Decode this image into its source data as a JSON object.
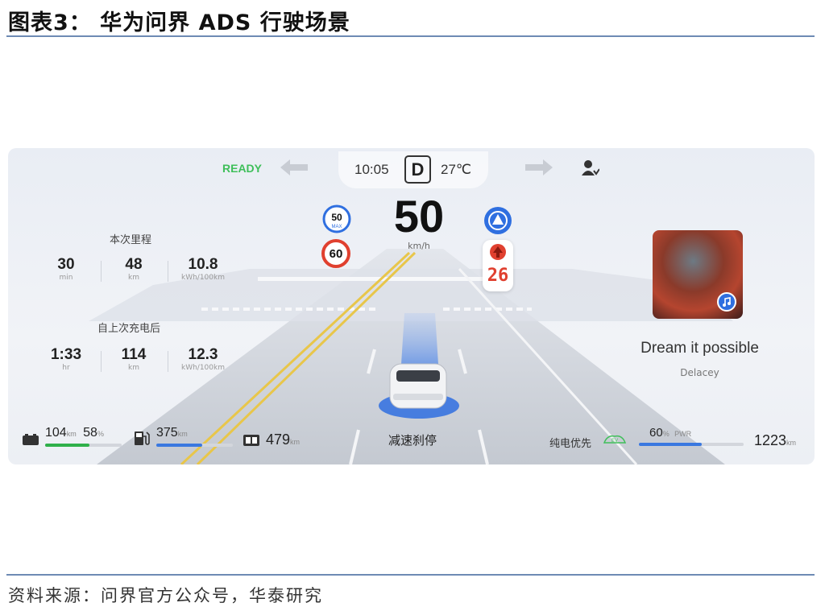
{
  "figure": {
    "title": "图表3： 华为问界 ADS 行驶场景",
    "source": "资料来源：问界官方公众号，华泰研究"
  },
  "dashboard": {
    "status": "READY",
    "time": "10:05",
    "gear": "D",
    "temperature": "27℃",
    "speed": "50",
    "speed_unit": "km/h",
    "max_speed": "50",
    "max_label": "MAX",
    "speed_limit": "60",
    "traffic_light_countdown": "26",
    "trip": {
      "title": "本次里程",
      "stats": [
        {
          "value": "30",
          "unit": "min"
        },
        {
          "value": "48",
          "unit": "km"
        },
        {
          "value": "10.8",
          "unit": "kWh/100km"
        }
      ]
    },
    "since_charge": {
      "title": "自上次充电后",
      "stats": [
        {
          "value": "1:33",
          "unit": "hr"
        },
        {
          "value": "114",
          "unit": "km"
        },
        {
          "value": "12.3",
          "unit": "kWh/100km"
        }
      ]
    },
    "battery": {
      "range": "104",
      "range_unit": "km",
      "percent": "58",
      "percent_unit": "%",
      "fill": 0.58
    },
    "fuel": {
      "range": "375",
      "range_unit": "km",
      "fill": 0.6
    },
    "total_range": {
      "value": "479",
      "unit": "km"
    },
    "brake_status": "减速刹停",
    "drive_mode": "纯电优先",
    "ev_label": "EV",
    "power": {
      "value": "60",
      "unit": "%",
      "label": "PWR",
      "fill": 0.6
    },
    "odometer": {
      "value": "1223",
      "unit": "km"
    },
    "media": {
      "song": "Dream it possible",
      "artist": "Delacey"
    }
  },
  "colors": {
    "ready": "#3fbf5a",
    "battery_bar": "#2fb04a",
    "fuel_bar": "#3a78e0",
    "accent_blue": "#2f6fe0",
    "road": "#cdd1d8",
    "lane_yellow": "#e8c64a",
    "countdown_red": "#e0402f",
    "rule_blue": "#6e8bb4"
  }
}
